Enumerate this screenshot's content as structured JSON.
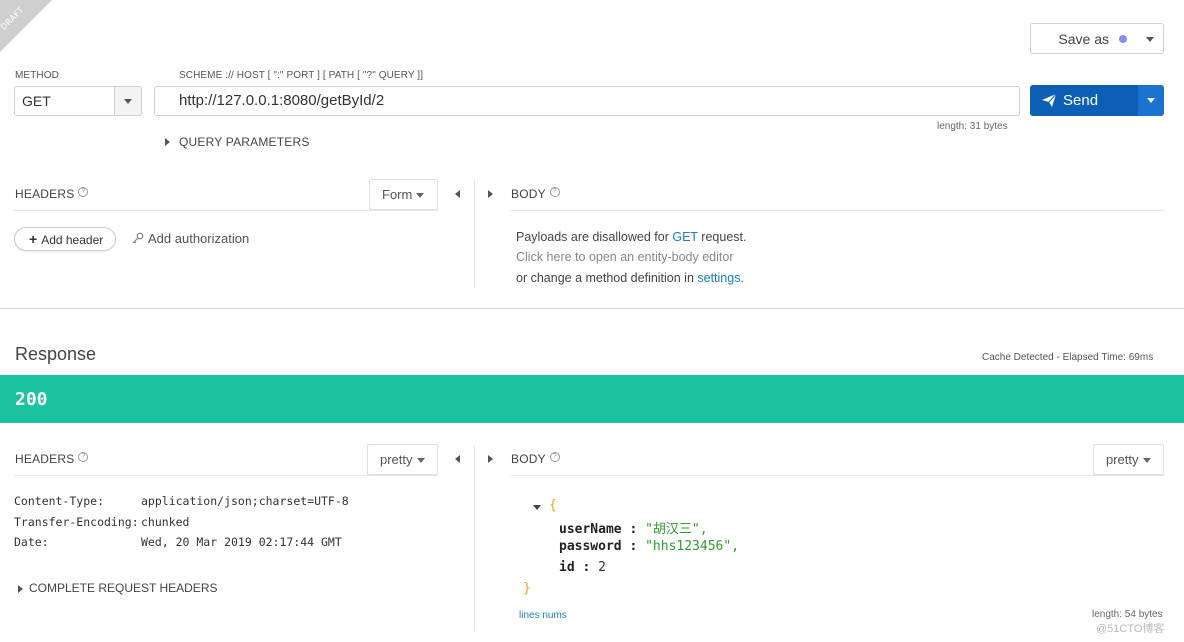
{
  "request": {
    "draft_label": "DRAFT",
    "save_as_label": "Save as",
    "method_label": "METHOD",
    "method_value": "GET",
    "url_label": "SCHEME :// HOST [ \":\" PORT ] [ PATH [ \"?\" QUERY ]]",
    "url_value": "http://127.0.0.1:8080/getById/2",
    "url_length": "length: 31 bytes",
    "send_label": "Send",
    "query_params_label": "QUERY PARAMETERS",
    "headers_label": "HEADERS",
    "headers_mode": "Form",
    "body_label": "BODY",
    "add_header_label": "Add header",
    "add_auth_label": "Add authorization",
    "body_message": {
      "line1_prefix": "Payloads are disallowed for ",
      "line1_link": "GET",
      "line1_suffix": " request.",
      "line2": "Click here to open an entity-body editor",
      "line3_prefix": "or change a method definition in ",
      "line3_link": "settings",
      "line3_suffix": "."
    }
  },
  "response": {
    "title": "Response",
    "cache_info": "Cache Detected - Elapsed Time: 69ms",
    "status_code": "200",
    "status_color": "#1bc29f",
    "headers_label": "HEADERS",
    "headers_mode": "pretty",
    "body_label": "BODY",
    "body_mode": "pretty",
    "headers": [
      {
        "key": "Content-Type:",
        "value": "application/json;charset=UTF-8"
      },
      {
        "key": "Transfer-Encoding:",
        "value": "chunked"
      },
      {
        "key": "Date:",
        "value": "Wed, 20 Mar 2019 02:17:44 GMT"
      }
    ],
    "complete_headers_label": "COMPLETE REQUEST HEADERS",
    "json": {
      "open": "{",
      "close": "}",
      "fields": [
        {
          "key": "userName",
          "value": "\"胡汉三\","
        },
        {
          "key": "password",
          "value": "\"hhs123456\","
        },
        {
          "key": "id",
          "value": "2"
        }
      ]
    },
    "lines_nums_label": "lines nums",
    "body_length": "length: 54 bytes",
    "watermark": "@51CTO博客"
  },
  "colors": {
    "send_button": "#0d5fb5",
    "link": "#1a7fc2",
    "json_string": "#2f9c2f",
    "json_brace": "#e6a319"
  }
}
